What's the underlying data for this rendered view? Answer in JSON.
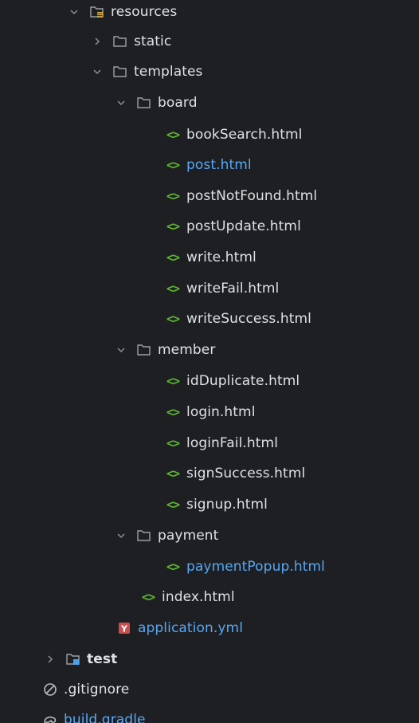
{
  "tree": {
    "resources": "resources",
    "static": "static",
    "templates": "templates",
    "board": "board",
    "board_files": [
      "bookSearch.html",
      "post.html",
      "postNotFound.html",
      "postUpdate.html",
      "write.html",
      "writeFail.html",
      "writeSuccess.html"
    ],
    "member": "member",
    "member_files": [
      "idDuplicate.html",
      "login.html",
      "loginFail.html",
      "signSuccess.html",
      "signup.html"
    ],
    "payment": "payment",
    "payment_files": [
      "paymentPopup.html"
    ],
    "index": "index.html",
    "application": "application.yml",
    "test": "test",
    "gitignore": ".gitignore",
    "build": "build.gradle",
    "html_icon_glyph": "<>",
    "yml_icon_glyph": "Y"
  },
  "colors": {
    "background": "#1e1f22",
    "text": "#dfe1e5",
    "modified": "#56a8f5",
    "html_icon": "#5fb832",
    "yml_icon": "#c94f4f",
    "chevron": "#8c8f94",
    "folder": "#9aa0a6"
  }
}
